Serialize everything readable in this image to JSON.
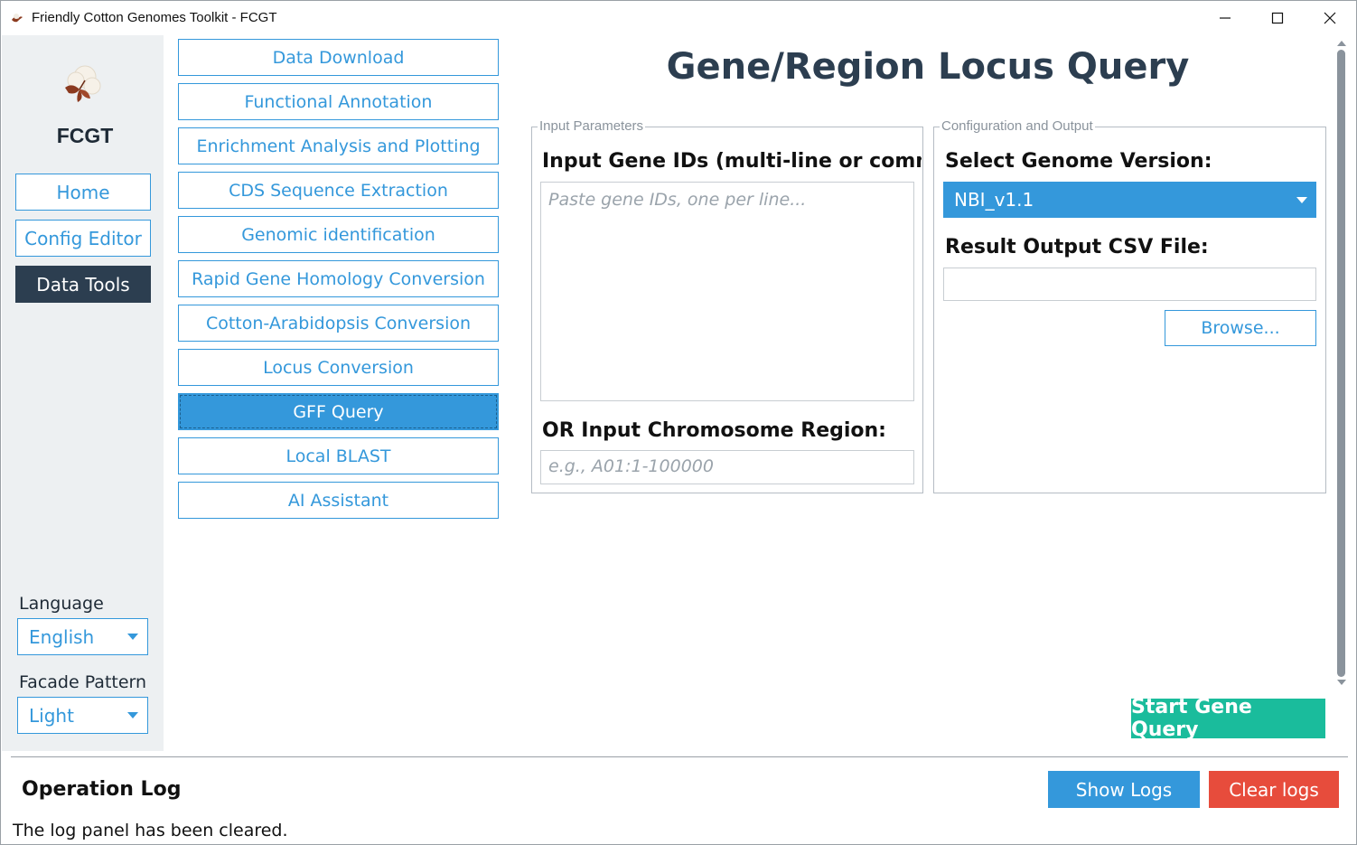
{
  "window": {
    "title": "Friendly Cotton Genomes Toolkit - FCGT"
  },
  "sidebar": {
    "brand": "FCGT",
    "nav": [
      {
        "label": "Home"
      },
      {
        "label": "Config Editor"
      },
      {
        "label": "Data Tools"
      }
    ],
    "language_label": "Language",
    "language_value": "English",
    "facade_label": "Facade Pattern",
    "facade_value": "Light"
  },
  "tools": [
    {
      "label": "Data Download"
    },
    {
      "label": "Functional Annotation"
    },
    {
      "label": "Enrichment Analysis and Plotting"
    },
    {
      "label": "CDS Sequence Extraction"
    },
    {
      "label": "Genomic identification"
    },
    {
      "label": "Rapid Gene Homology Conversion"
    },
    {
      "label": "Cotton-Arabidopsis Conversion"
    },
    {
      "label": "Locus Conversion"
    },
    {
      "label": "GFF Query"
    },
    {
      "label": "Local BLAST"
    },
    {
      "label": "AI Assistant"
    }
  ],
  "main": {
    "title": "Gene/Region Locus Query",
    "input_group": {
      "legend": "Input Parameters",
      "gene_ids_label": "Input Gene IDs (multi-line or comma",
      "gene_ids_placeholder": "Paste gene IDs, one per line...",
      "region_label": "OR Input Chromosome Region:",
      "region_placeholder": "e.g., A01:1-100000"
    },
    "config_group": {
      "legend": "Configuration and Output",
      "genome_label": "Select Genome Version:",
      "genome_value": "NBI_v1.1",
      "output_label": "Result Output CSV File:",
      "output_value": "",
      "browse_label": "Browse..."
    },
    "start_label": "Start Gene Query"
  },
  "log": {
    "title": "Operation Log",
    "show_label": "Show Logs",
    "clear_label": "Clear logs",
    "message": "The log panel has been cleared."
  },
  "colors": {
    "accent": "#3498db",
    "dark": "#2c3e50",
    "success": "#1abc9c",
    "danger": "#e74c3c",
    "sidebar_bg": "#edf0f2"
  }
}
